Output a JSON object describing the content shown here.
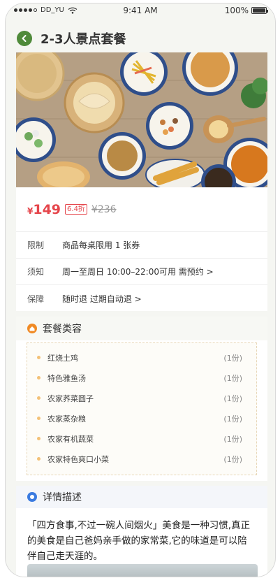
{
  "status_bar": {
    "carrier": "DD_YU",
    "time": "9:41 AM",
    "battery": "100%"
  },
  "header": {
    "title": "2-3人景点套餐"
  },
  "price": {
    "currency": "¥",
    "current": "149",
    "discount": "6.4折",
    "original": "¥236"
  },
  "info_rows": [
    {
      "label": "限制",
      "value": "商品每桌限用 1 张券"
    },
    {
      "label": "须知",
      "value": "周一至周日 10:00–22:00可用 需预约 >"
    },
    {
      "label": "保障",
      "value": "随时退 过期自动退 >"
    }
  ],
  "package": {
    "title": "套餐类容",
    "items": [
      {
        "name": "红烧土鸡",
        "qty": "(1份)"
      },
      {
        "name": "特色雅鱼汤",
        "qty": "(1份)"
      },
      {
        "name": "农家荞菜圆子",
        "qty": "(1份)"
      },
      {
        "name": "农家蒸杂粮",
        "qty": "(1份)"
      },
      {
        "name": "农家有机蔬菜",
        "qty": "(1份)"
      },
      {
        "name": "农家特色爽口小菜",
        "qty": "(1份)"
      }
    ]
  },
  "detail": {
    "title": "详情描述",
    "text": "「四方食事,不过一碗人间烟火」美食是一种习惯,真正的美食是自己爸妈亲手做的家常菜,它的味道是可以陪伴自己走天涯的。"
  },
  "colors": {
    "accent_green": "#4f8a3a",
    "price_red": "#e5454b",
    "bullet_orange": "#f3c177",
    "package_icon": "#f08a24",
    "detail_icon": "#3b7be0"
  }
}
